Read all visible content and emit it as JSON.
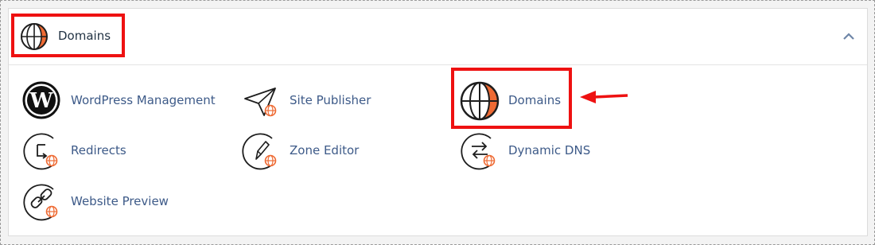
{
  "section": {
    "title": "Domains",
    "collapse_icon": "chevron-up-icon"
  },
  "tools": [
    {
      "label": "WordPress Management",
      "icon": "wordpress-icon"
    },
    {
      "label": "Site Publisher",
      "icon": "paper-plane-icon"
    },
    {
      "label": "Domains",
      "icon": "globe-icon"
    },
    {
      "label": "Redirects",
      "icon": "redirect-icon"
    },
    {
      "label": "Zone Editor",
      "icon": "zone-editor-icon"
    },
    {
      "label": "Dynamic DNS",
      "icon": "dynamic-dns-icon"
    },
    {
      "label": "Website Preview",
      "icon": "link-icon"
    }
  ],
  "annotations": {
    "highlight_color": "#ee1111",
    "arrow_color": "#ee1111"
  },
  "colors": {
    "link": "#3d5a88",
    "globe_accent": "#ee6a33",
    "icon_stroke": "#1d1d1d"
  }
}
